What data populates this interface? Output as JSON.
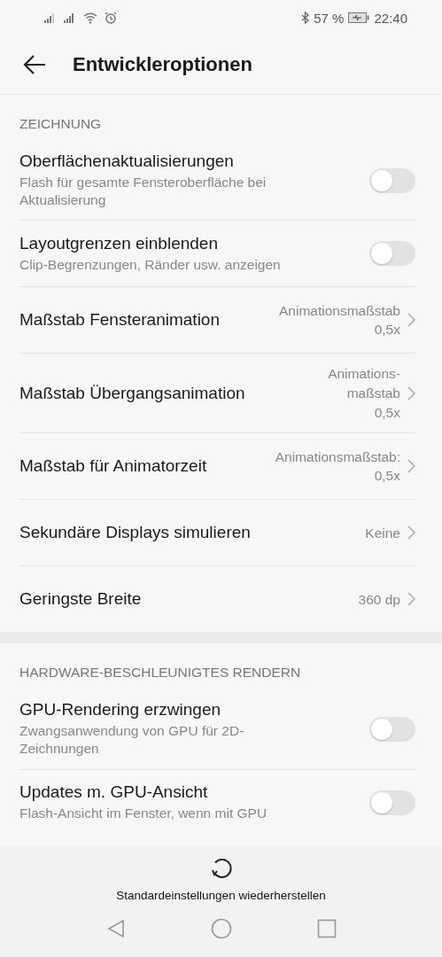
{
  "status_bar": {
    "battery": "57 %",
    "time": "22:40"
  },
  "header": {
    "title": "Entwickleroptionen"
  },
  "sections": [
    {
      "title": "ZEICHNUNG",
      "items": [
        {
          "kind": "toggle",
          "title": "Oberflächenaktualisierungen",
          "subtitle": "Flash für gesamte Fensteroberfläche bei Aktualisierung",
          "on": false
        },
        {
          "kind": "toggle",
          "title": "Layoutgrenzen einblenden",
          "subtitle": "Clip-Begrenzungen, Ränder usw. anzeigen",
          "on": false
        },
        {
          "kind": "link",
          "title": "Maßstab Fensteranimation",
          "value_lines": [
            "Animationsmaßstab",
            "0,5x"
          ]
        },
        {
          "kind": "link",
          "title": "Maßstab Übergangsanimation",
          "value_lines": [
            "Animations-",
            "maßstab",
            "0,5x"
          ]
        },
        {
          "kind": "link",
          "title": "Maßstab für Animatorzeit",
          "value_lines": [
            "Animationsmaßstab:",
            "0,5x"
          ]
        },
        {
          "kind": "link",
          "title": "Sekundäre Displays simulieren",
          "value_lines": [
            "Keine"
          ]
        },
        {
          "kind": "link",
          "title": "Geringste Breite",
          "value_lines": [
            "360 dp"
          ]
        }
      ]
    },
    {
      "title": "HARDWARE-BESCHLEUNIGTES RENDERN",
      "items": [
        {
          "kind": "toggle",
          "title": "GPU-Rendering erzwingen",
          "subtitle": "Zwangsanwendung von GPU für 2D-Zeichnungen",
          "on": false
        },
        {
          "kind": "toggle",
          "title": "Updates m. GPU-Ansicht",
          "subtitle": "Flash-Ansicht im Fenster, wenn mit GPU",
          "on": false
        }
      ]
    }
  ],
  "bottom_action": {
    "label": "Standardeinstellungen wiederherstellen"
  }
}
